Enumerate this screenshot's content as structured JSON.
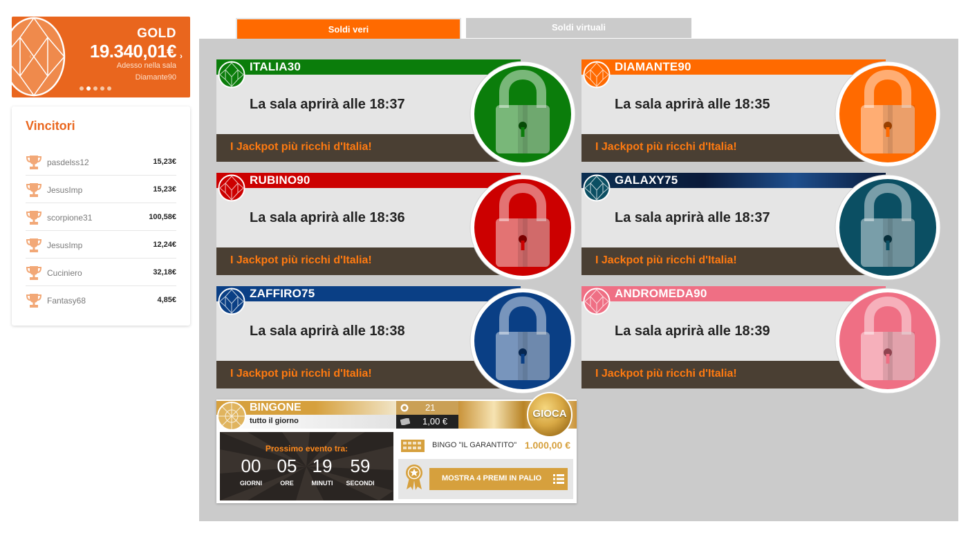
{
  "jackpot": {
    "type": "GOLD",
    "amount": "19.340,01€",
    "caption": "Adesso nella sala",
    "room": "Diamante90",
    "arrow_left": "‹",
    "arrow_right": "›",
    "dot_count": 5,
    "active_dot": 1
  },
  "winners": {
    "title": "Vincitori",
    "rows": [
      {
        "name": "pasdelss12",
        "amount": "15,23€"
      },
      {
        "name": "JesusImp",
        "amount": "15,23€"
      },
      {
        "name": "scorpione31",
        "amount": "100,58€"
      },
      {
        "name": "JesusImp",
        "amount": "12,24€"
      },
      {
        "name": "Cuciniero",
        "amount": "32,18€"
      },
      {
        "name": "Fantasy68",
        "amount": "4,85€"
      }
    ]
  },
  "tabs": {
    "real": "Soldi veri",
    "virtual": "Soldi virtuali"
  },
  "rooms": [
    {
      "name": "ITALIA30",
      "open_text": "La sala aprirà alle 18:37",
      "footer": "I Jackpot più ricchi d'Italia!",
      "color": "#0b7d0b"
    },
    {
      "name": "DIAMANTE90",
      "open_text": "La sala aprirà alle 18:35",
      "footer": "I Jackpot più ricchi d'Italia!",
      "color": "#ff6a00"
    },
    {
      "name": "RUBINO90",
      "open_text": "La sala aprirà alle 18:36",
      "footer": "I Jackpot più ricchi d'Italia!",
      "color": "#cc0000"
    },
    {
      "name": "GALAXY75",
      "open_text": "La sala aprirà alle 18:37",
      "footer": "I Jackpot più ricchi d'Italia!",
      "color": "#0b4f63"
    },
    {
      "name": "ZAFFIRO75",
      "open_text": "La sala aprirà alle 18:38",
      "footer": "I Jackpot più ricchi d'Italia!",
      "color": "#0a3f85"
    },
    {
      "name": "ANDROMEDA90",
      "open_text": "La sala aprirà alle 18:39",
      "footer": "I Jackpot più ricchi d'Italia!",
      "color": "#ef6f84"
    }
  ],
  "bingone": {
    "name": "BINGONE",
    "subtitle": "tutto il giorno",
    "players": "21",
    "price": "1,00 €",
    "play_label": "GIOCA",
    "countdown_title": "Prossimo evento tra:",
    "countdown": [
      {
        "value": "00",
        "label": "GIORNI"
      },
      {
        "value": "05",
        "label": "ORE"
      },
      {
        "value": "19",
        "label": "MINUTI"
      },
      {
        "value": "59",
        "label": "SECONDI"
      }
    ],
    "prize_name": "BINGO \"IL GARANTITO\"",
    "prize_amount": "1.000,00 €",
    "show_prizes": "MOSTRA 4 PREMI IN PALIO"
  },
  "colors": {
    "accent": "#e9661e",
    "tab_active": "#ff6a00",
    "panel": "#cbcbcb",
    "footer_bg": "#4a3f33",
    "footer_text": "#ff7a10",
    "gold": "#d6a03d"
  }
}
